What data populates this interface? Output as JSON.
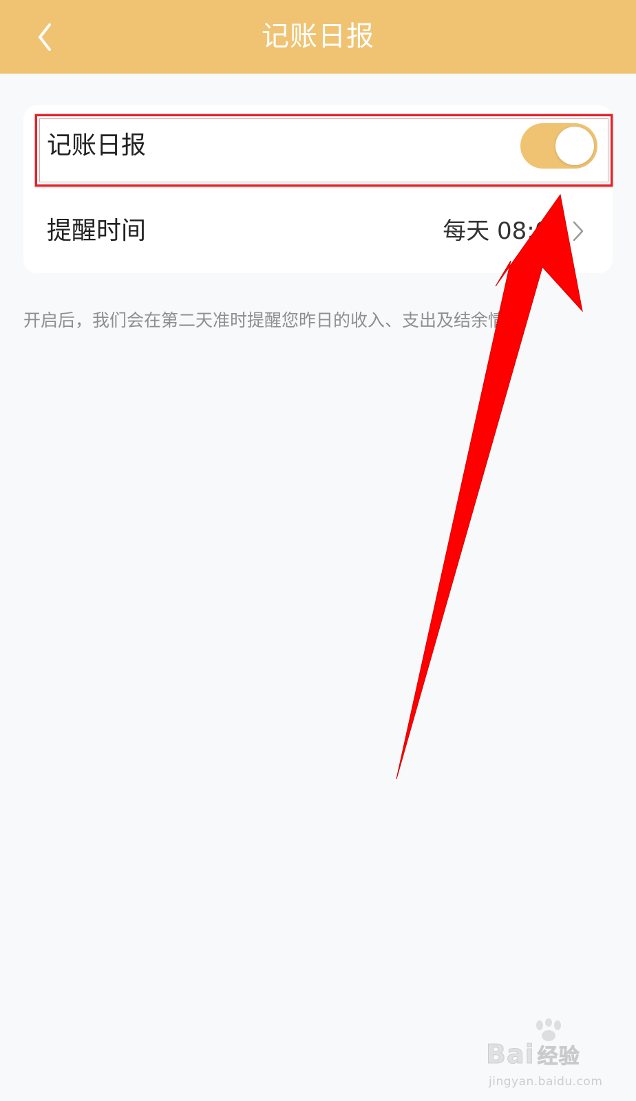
{
  "header": {
    "title": "记账日报",
    "background_color": "#efc372",
    "back_icon": "chevron-left-icon"
  },
  "settings": {
    "daily_report": {
      "label": "记账日报",
      "enabled": true,
      "toggle_color": "#efc372"
    },
    "reminder_time": {
      "label": "提醒时间",
      "value": "每天 08:00",
      "chevron_icon": "chevron-right-icon"
    }
  },
  "hint_text": "开启后，我们会在第二天准时提醒您昨日的收入、支出及结余情况.",
  "annotation": {
    "highlight_color": "#e8202a",
    "arrow_color": "#ff0000"
  },
  "watermark": {
    "brand": "Bai",
    "brand_suffix": "经验",
    "url": "jingyan.baidu.com"
  }
}
